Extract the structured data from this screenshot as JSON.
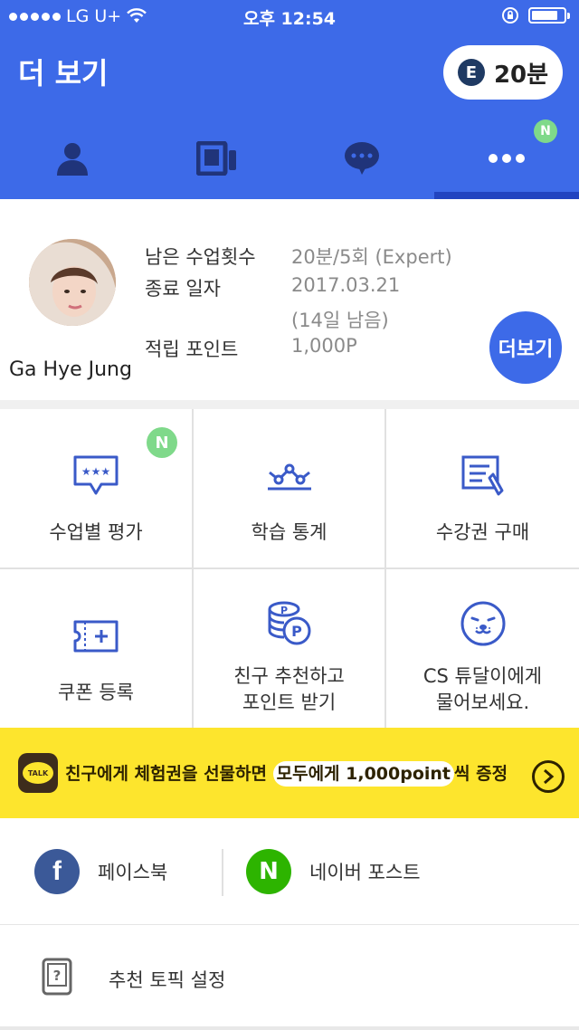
{
  "status_bar": {
    "carrier": "LG U+",
    "time": "오후 12:54"
  },
  "header": {
    "title": "더 보기",
    "credit_badge": "E",
    "credit_text": "20분"
  },
  "tabs": [
    {
      "icon": "person-icon"
    },
    {
      "icon": "tablet-icon"
    },
    {
      "icon": "chat-bubble-icon"
    },
    {
      "icon": "more-dots-icon",
      "new_badge": "N"
    }
  ],
  "profile": {
    "name": "Ga Hye Jung",
    "remaining_label": "남은 수업횟수",
    "remaining_value": "20분/5회 (Expert)",
    "end_label": "종료 일자",
    "end_value": "2017.03.21",
    "end_remaining": "(14일 남음)",
    "points_label": "적립 포인트",
    "points_value": "1,000P",
    "more_button": "더보기"
  },
  "menu": [
    {
      "label": "수업별 평가",
      "icon": "rating-bubble-icon",
      "badge": "N"
    },
    {
      "label": "학습 통계",
      "icon": "stats-line-icon"
    },
    {
      "label": "수강권 구매",
      "icon": "document-pen-icon"
    },
    {
      "label": "쿠폰 등록",
      "icon": "coupon-icon"
    },
    {
      "label_line1": "친구 추천하고",
      "label_line2": "포인트 받기",
      "icon": "coins-icon"
    },
    {
      "label_line1": "CS 튜달이에게",
      "label_line2": "물어보세요.",
      "icon": "seal-face-icon"
    }
  ],
  "banner": {
    "talk": "TALK",
    "text_before": "친구에게 체험권을 선물하면 ",
    "text_highlight": "모두에게 1,000point",
    "text_after": "씩 증정"
  },
  "social": {
    "facebook_label": "페이스북",
    "facebook_glyph": "f",
    "naver_label": "네이버 포스트",
    "naver_glyph": "N"
  },
  "recommend": {
    "label": "추천 토픽 설정"
  }
}
